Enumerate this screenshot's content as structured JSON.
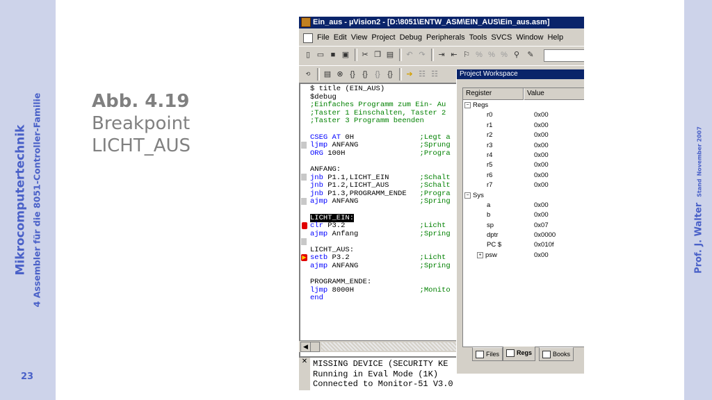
{
  "slide": {
    "title_vertical": "Mikrocomputertechnik",
    "subtitle_vertical": "4 Assembler für die 8051-Controller-Familie",
    "page_number": "23",
    "author": "Prof. J. Walter",
    "stand_label": "Stand",
    "date": "November 2007",
    "caption_title": "Abb. 4.19",
    "caption_line2": "Breakpoint",
    "caption_line3": "LICHT_AUS"
  },
  "window": {
    "title": "Ein_aus  - µVision2 - [D:\\8051\\ENTW_ASM\\EIN_AUS\\Ein_aus.asm]",
    "menu": [
      "File",
      "Edit",
      "View",
      "Project",
      "Debug",
      "Peripherals",
      "Tools",
      "SVCS",
      "Window",
      "Help"
    ]
  },
  "editor": {
    "lines": [
      {
        "parts": [
          {
            "t": "$ title (EIN_AUS)",
            "c": "tx"
          }
        ]
      },
      {
        "parts": [
          {
            "t": "$debug",
            "c": "tx"
          }
        ]
      },
      {
        "parts": [
          {
            "t": ";Einfaches Programm zum Ein- Au",
            "c": "cm"
          }
        ]
      },
      {
        "parts": [
          {
            "t": ";Taster 1 Einschalten, Taster 2",
            "c": "cm"
          }
        ]
      },
      {
        "parts": [
          {
            "t": ";Taster 3 Programm beenden",
            "c": "cm"
          }
        ]
      },
      {
        "parts": [
          {
            "t": "",
            "c": "tx"
          }
        ]
      },
      {
        "parts": [
          {
            "t": "CSEG AT",
            "c": "kw"
          },
          {
            "t": " 0H               ",
            "c": "tx"
          },
          {
            "t": ";Legt a",
            "c": "cm"
          }
        ]
      },
      {
        "parts": [
          {
            "t": "ljmp",
            "c": "kw"
          },
          {
            "t": " ANFANG              ",
            "c": "tx"
          },
          {
            "t": ";Sprung",
            "c": "cm"
          }
        ]
      },
      {
        "parts": [
          {
            "t": "ORG",
            "c": "kw"
          },
          {
            "t": " 100H                 ",
            "c": "tx"
          },
          {
            "t": ";Progra",
            "c": "cm"
          }
        ]
      },
      {
        "parts": [
          {
            "t": "",
            "c": "tx"
          }
        ]
      },
      {
        "parts": [
          {
            "t": "ANFANG:",
            "c": "tx"
          }
        ]
      },
      {
        "parts": [
          {
            "t": "jnb",
            "c": "kw"
          },
          {
            "t": " P1.1,LICHT_EIN       ",
            "c": "tx"
          },
          {
            "t": ";Schalt",
            "c": "cm"
          }
        ]
      },
      {
        "parts": [
          {
            "t": "jnb",
            "c": "kw"
          },
          {
            "t": " P1.2,LICHT_AUS       ",
            "c": "tx"
          },
          {
            "t": ";Schalt",
            "c": "cm"
          }
        ]
      },
      {
        "parts": [
          {
            "t": "jnb",
            "c": "kw"
          },
          {
            "t": " P1.3,PROGRAMM_ENDE   ",
            "c": "tx"
          },
          {
            "t": ";Progra",
            "c": "cm"
          }
        ]
      },
      {
        "parts": [
          {
            "t": "ajmp",
            "c": "kw"
          },
          {
            "t": " ANFANG              ",
            "c": "tx"
          },
          {
            "t": ";Spring",
            "c": "cm"
          }
        ]
      },
      {
        "parts": [
          {
            "t": "",
            "c": "tx"
          }
        ]
      },
      {
        "parts": [
          {
            "t": "LICHT_EIN:",
            "c": "hl"
          }
        ]
      },
      {
        "parts": [
          {
            "t": "clr",
            "c": "kw"
          },
          {
            "t": " P3.2                 ",
            "c": "tx"
          },
          {
            "t": ";Licht",
            "c": "cm"
          }
        ]
      },
      {
        "parts": [
          {
            "t": "ajmp",
            "c": "kw"
          },
          {
            "t": " Anfang              ",
            "c": "tx"
          },
          {
            "t": ";Spring",
            "c": "cm"
          }
        ]
      },
      {
        "parts": [
          {
            "t": "",
            "c": "tx"
          }
        ]
      },
      {
        "parts": [
          {
            "t": "LICHT_AUS:",
            "c": "tx"
          }
        ]
      },
      {
        "parts": [
          {
            "t": "setb",
            "c": "kw"
          },
          {
            "t": " P3.2                ",
            "c": "tx"
          },
          {
            "t": ";Licht",
            "c": "cm"
          }
        ]
      },
      {
        "parts": [
          {
            "t": "ajmp",
            "c": "kw"
          },
          {
            "t": " ANFANG              ",
            "c": "tx"
          },
          {
            "t": ";Spring",
            "c": "cm"
          }
        ]
      },
      {
        "parts": [
          {
            "t": "",
            "c": "tx"
          }
        ]
      },
      {
        "parts": [
          {
            "t": "PROGRAMM_ENDE:",
            "c": "tx"
          }
        ]
      },
      {
        "parts": [
          {
            "t": "ljmp",
            "c": "kw"
          },
          {
            "t": " 8000H               ",
            "c": "tx"
          },
          {
            "t": ";Monito",
            "c": "cm"
          }
        ]
      },
      {
        "parts": [
          {
            "t": "end",
            "c": "kw"
          }
        ]
      }
    ]
  },
  "output": {
    "lines": [
      "MISSING DEVICE (SECURITY KE",
      "Running in Eval Mode (1K)",
      "Connected to Monitor-51 V3.0"
    ]
  },
  "workspace": {
    "title": "Project Workspace",
    "col_register": "Register",
    "col_value": "Value",
    "rows": [
      {
        "k": "Regs",
        "v": "",
        "lvl": 0,
        "pm": "-"
      },
      {
        "k": "r0",
        "v": "0x00",
        "lvl": 1,
        "pm": ""
      },
      {
        "k": "r1",
        "v": "0x00",
        "lvl": 1,
        "pm": ""
      },
      {
        "k": "r2",
        "v": "0x00",
        "lvl": 1,
        "pm": ""
      },
      {
        "k": "r3",
        "v": "0x00",
        "lvl": 1,
        "pm": ""
      },
      {
        "k": "r4",
        "v": "0x00",
        "lvl": 1,
        "pm": ""
      },
      {
        "k": "r5",
        "v": "0x00",
        "lvl": 1,
        "pm": ""
      },
      {
        "k": "r6",
        "v": "0x00",
        "lvl": 1,
        "pm": ""
      },
      {
        "k": "r7",
        "v": "0x00",
        "lvl": 1,
        "pm": ""
      },
      {
        "k": "Sys",
        "v": "",
        "lvl": 0,
        "pm": "-"
      },
      {
        "k": "a",
        "v": "0x00",
        "lvl": 1,
        "pm": ""
      },
      {
        "k": "b",
        "v": "0x00",
        "lvl": 1,
        "pm": ""
      },
      {
        "k": "sp",
        "v": "0x07",
        "lvl": 1,
        "pm": ""
      },
      {
        "k": "dptr",
        "v": "0x0000",
        "lvl": 1,
        "pm": ""
      },
      {
        "k": "PC  $",
        "v": "0x010f",
        "lvl": 1,
        "pm": ""
      },
      {
        "k": "psw",
        "v": "0x00",
        "lvl": 1,
        "pm": "+"
      }
    ],
    "tabs": [
      "Files",
      "Regs",
      "Books"
    ],
    "active_tab": "Regs"
  }
}
